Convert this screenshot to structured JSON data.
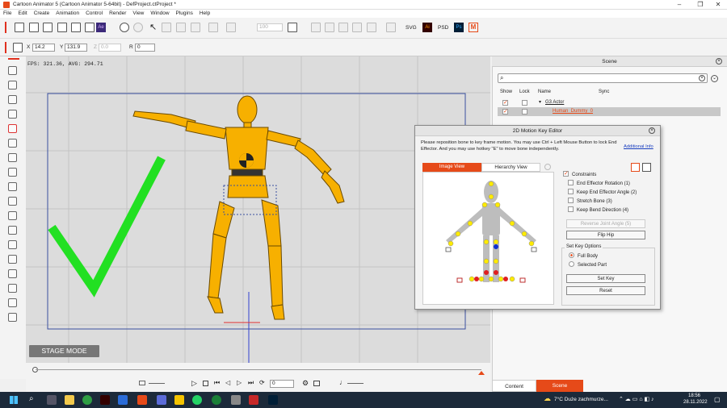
{
  "window": {
    "title": "Cartoon Animator 5  (Cartoon Animator 5-64bit) - DefProject.ctProject *"
  },
  "menu": [
    "File",
    "Edit",
    "Create",
    "Animation",
    "Control",
    "Render",
    "View",
    "Window",
    "Plugins",
    "Help"
  ],
  "toolbar": {
    "svg": "SVG",
    "psd": "PSD",
    "opacity": "100",
    "ai_badge": "Ai",
    "ps_badge": "Ps",
    "ae_badge": "Ae"
  },
  "transform": {
    "x_label": "X",
    "x": "14.2",
    "y_label": "Y",
    "y": "131.9",
    "z_label": "Z",
    "z": "0.0",
    "r_label": "R",
    "r": "0"
  },
  "stage": {
    "fps": "FPS: 321.36, AVG: 294.71",
    "mode_button": "STAGE MODE"
  },
  "timeline": {
    "frame": "0"
  },
  "scene": {
    "title": "Scene",
    "columns": [
      "Show",
      "Lock",
      "Name",
      "Sync"
    ],
    "rows": [
      {
        "name": "G3 Actor"
      },
      {
        "name": "Human_Dummy_0"
      }
    ],
    "tabs": [
      "Content",
      "Scene"
    ]
  },
  "dialog": {
    "title": "2D Motion Key Editor",
    "instruction": "Please reposition bone to key frame motion. You may use Ctrl + Left Mouse Button to lock End Effector. And you may use hotkey \"E\" to move bone independently.",
    "link": "Additional Info",
    "tabs": [
      "Image View",
      "Hierarchy View"
    ],
    "constraints": "Constraints",
    "options": [
      "End Effector Rotation (1)",
      "Keep End Effector Angle (2)",
      "Stretch Bone (3)",
      "Keep Bend Direction (4)"
    ],
    "reverse_joint": "Reverse Joint Angle (5)",
    "flip_hip": "Flip Hip",
    "setkey_options": "Set Key Options",
    "full_body": "Full Body",
    "selected_part": "Selected Part",
    "set_key": "Set Key",
    "reset": "Reset"
  },
  "taskbar": {
    "weather": "7°C  Duże zachmurze...",
    "time": "18:56",
    "date": "28.11.2022"
  }
}
